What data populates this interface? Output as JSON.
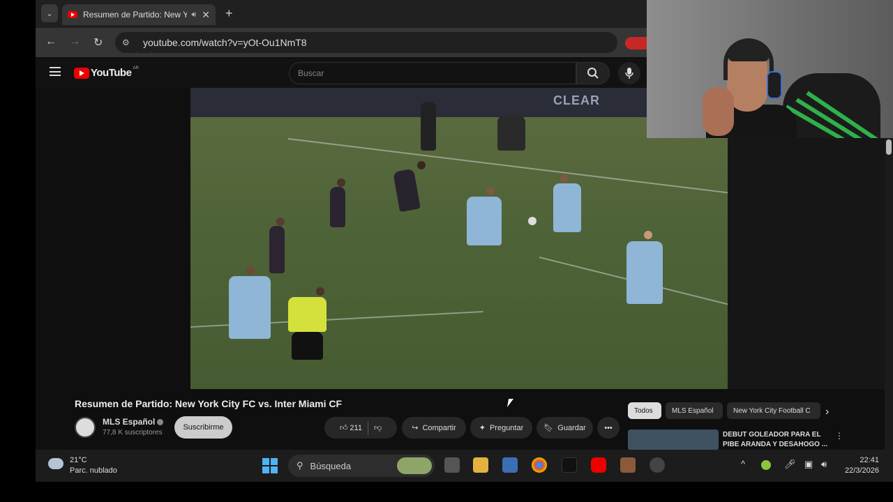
{
  "browser": {
    "tab_title": "Resumen de Partido: New Y",
    "tab_audio_icon": "speaker-icon",
    "tab_close": "✕",
    "new_tab": "+",
    "url": "youtube.com/watch?v=yOt-Ou1NmT8"
  },
  "youtube": {
    "logo_text": "YouTube",
    "country_code": "AR",
    "search_placeholder": "Buscar",
    "video_title": "Resumen de Partido: New York City FC vs. Inter Miami CF",
    "channel_name": "MLS Español",
    "channel_subs": "77,8 K suscriptores",
    "subscribe_label": "Suscribirme",
    "like_count": "211",
    "share_label": "Compartir",
    "ask_label": "Preguntar",
    "save_label": "Guardar",
    "video_overlay_text": "CLEAR",
    "chips": [
      "Todos",
      "MLS Español",
      "New York City Football C"
    ],
    "recommendation_title": "DEBUT GOLEADOR PARA EL PIBE ARANDA Y DESAHOGO ..."
  },
  "taskbar": {
    "temperature": "21°C",
    "weather_desc": "Parc. nublado",
    "search_label": "Búsqueda",
    "time": "22:41",
    "date": "22/3/2026"
  },
  "colors": {
    "youtube_red": "#e00000",
    "pitch_green": "#4f6338",
    "accent_green": "#2fb04a"
  }
}
